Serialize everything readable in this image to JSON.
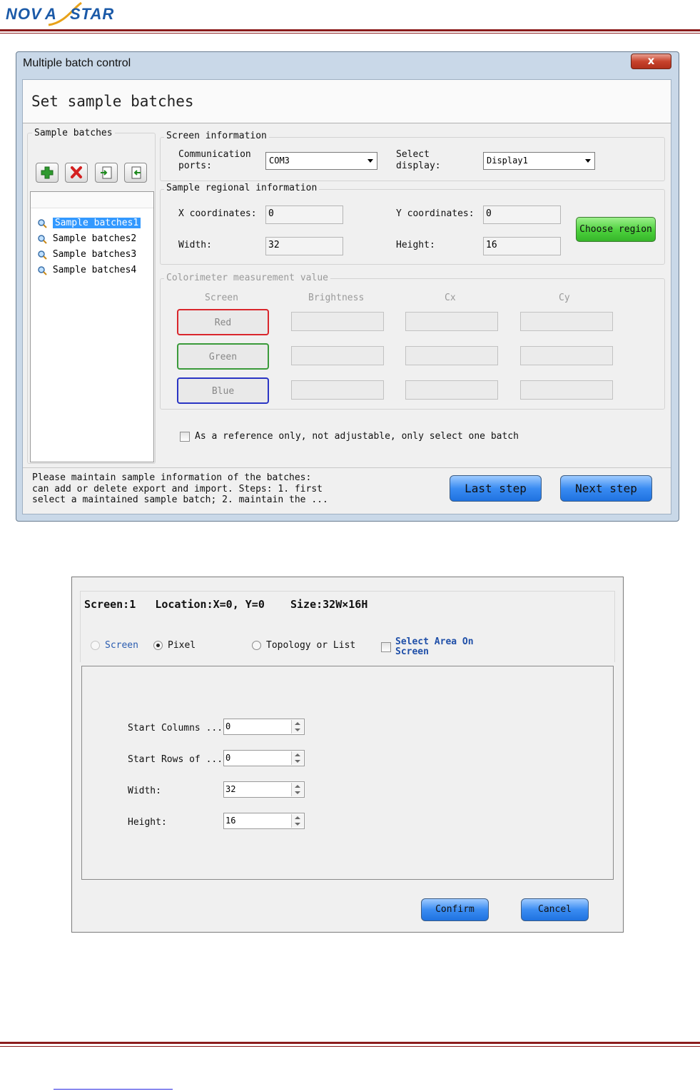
{
  "brand": {
    "logo_text_left": "NOVA",
    "logo_text_right": "STAR"
  },
  "colors": {
    "brand_red": "#8b1c1c",
    "accent_blue": "#3a8cf2",
    "choose_green": "#4cd13c",
    "red_border": "#d9262c",
    "green_border": "#3a9a3a",
    "blue_border": "#2a35c4"
  },
  "batch_dialog": {
    "window_title": "Multiple batch control",
    "close_label": "x",
    "heading": "Set sample batches",
    "sample_batches": {
      "group_label": "Sample batches",
      "tools": [
        "add-icon",
        "delete-icon",
        "export-icon",
        "import-icon"
      ],
      "items": [
        "Sample batches1",
        "Sample batches2",
        "Sample batches3",
        "Sample batches4"
      ],
      "selected_index": 0
    },
    "screen_info": {
      "group_label": "Screen information",
      "comm_label": "Communication\nports:",
      "comm_value": "COM3",
      "display_label": "Select\ndisplay:",
      "display_value": "Display1"
    },
    "regional": {
      "group_label": "Sample regional information",
      "x_label": "X coordinates:",
      "x_value": "0",
      "y_label": "Y coordinates:",
      "y_value": "0",
      "width_label": "Width:",
      "width_value": "32",
      "height_label": "Height:",
      "height_value": "16",
      "choose_label": "Choose region"
    },
    "colorimeter": {
      "group_label": "Colorimeter measurement value",
      "headers": [
        "Screen",
        "Brightness",
        "Cx",
        "Cy"
      ],
      "rows": [
        {
          "label": "Red",
          "brightness": "",
          "cx": "",
          "cy": ""
        },
        {
          "label": "Green",
          "brightness": "",
          "cx": "",
          "cy": ""
        },
        {
          "label": "Blue",
          "brightness": "",
          "cx": "",
          "cy": ""
        }
      ]
    },
    "reference_checkbox_label": "As a reference only, not adjustable, only select one batch",
    "reference_checked": false,
    "hint_lines": [
      "Please maintain sample information of the batches:",
      "can add or delete export and import. Steps: 1. first",
      "select a maintained sample batch; 2. maintain the ..."
    ],
    "last_step_label": "Last step",
    "next_step_label": "Next step"
  },
  "region_dialog": {
    "info": {
      "screen": "Screen:1",
      "location": "Location:X=0, Y=0",
      "size": "Size:32W×16H"
    },
    "modes": [
      {
        "label": "Screen",
        "selected": false,
        "enabled": false
      },
      {
        "label": "Pixel",
        "selected": true,
        "enabled": true
      },
      {
        "label": "Topology or List",
        "selected": false,
        "enabled": true
      }
    ],
    "select_area_label_1": "Select Area On",
    "select_area_label_2": "Screen",
    "select_area_checked": false,
    "fields": [
      {
        "label": "Start Columns ...",
        "value": "0"
      },
      {
        "label": "Start Rows of ...",
        "value": "0"
      },
      {
        "label": "Width:",
        "value": "32"
      },
      {
        "label": "Height:",
        "value": "16"
      }
    ],
    "confirm_label": "Confirm",
    "cancel_label": "Cancel"
  }
}
